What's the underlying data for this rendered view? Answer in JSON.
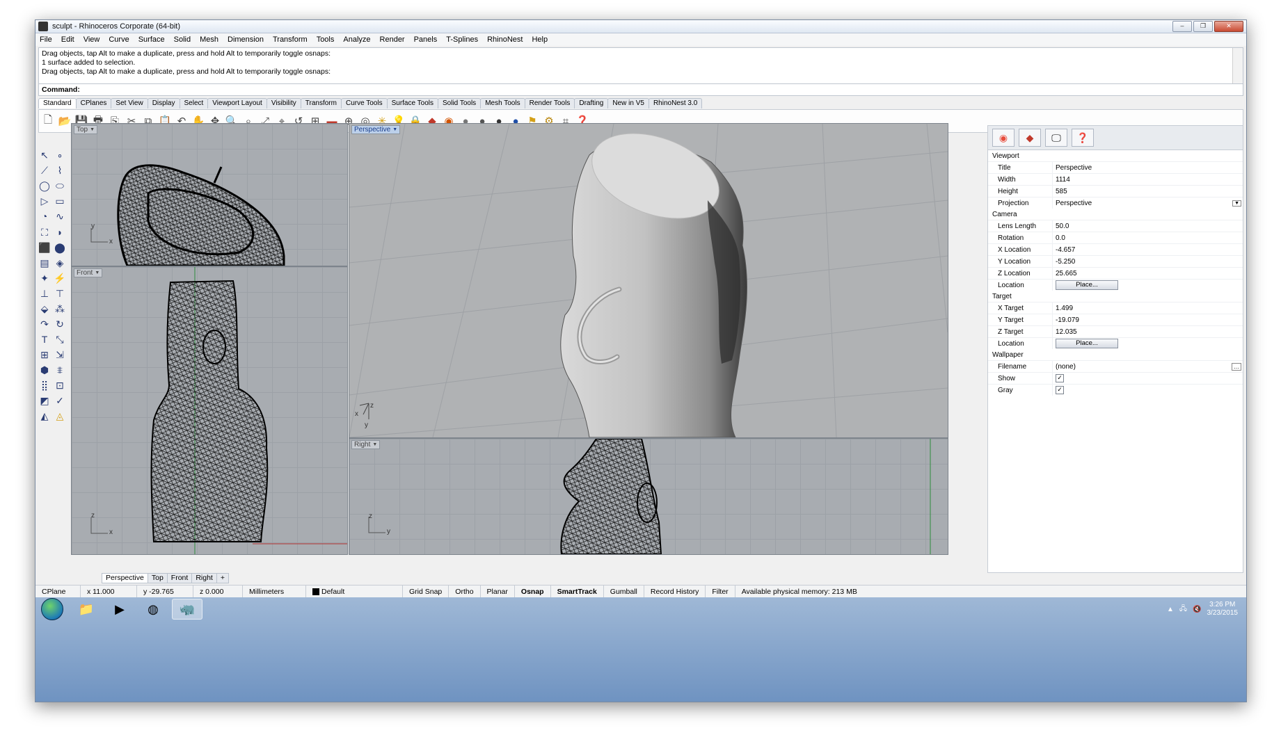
{
  "window": {
    "title": "sculpt - Rhinoceros Corporate (64-bit)",
    "controls": [
      "–",
      "❐",
      "✕"
    ]
  },
  "menu": [
    "File",
    "Edit",
    "View",
    "Curve",
    "Surface",
    "Solid",
    "Mesh",
    "Dimension",
    "Transform",
    "Tools",
    "Analyze",
    "Render",
    "Panels",
    "T-Splines",
    "RhinoNest",
    "Help"
  ],
  "command_history": [
    "Drag objects, tap Alt to make a duplicate, press and hold Alt to temporarily toggle osnaps:",
    "1 surface added to selection.",
    "Drag objects, tap Alt to make a duplicate, press and hold Alt to temporarily toggle osnaps:"
  ],
  "command": {
    "label": "Command:",
    "value": ""
  },
  "toolbar_tabs": [
    "Standard",
    "CPlanes",
    "Set View",
    "Display",
    "Select",
    "Viewport Layout",
    "Visibility",
    "Transform",
    "Curve Tools",
    "Surface Tools",
    "Solid Tools",
    "Mesh Tools",
    "Render Tools",
    "Drafting",
    "New in V5",
    "RhinoNest 3.0"
  ],
  "toolbar_icons": [
    "new-icon",
    "open-icon",
    "save-icon",
    "print-icon",
    "import-icon",
    "cut-icon",
    "copy-icon",
    "paste-icon",
    "undo-icon",
    "pan-icon",
    "rotate-view-icon",
    "zoom-icon",
    "zoom-window-icon",
    "zoom-extents-icon",
    "zoom-selected-icon",
    "undo-view-icon",
    "four-viewports-icon",
    "cplane-icon",
    "grid-icon",
    "osnap-icon",
    "point-icon",
    "light-icon",
    "lock-icon",
    "layer-icon",
    "material-icon",
    "render-sphere-icon",
    "shaded-sphere-icon",
    "rendered-sphere-icon",
    "blue-sphere-icon",
    "flag-icon",
    "settings-gear-icon",
    "gumball-icon",
    "help-icon"
  ],
  "viewports": {
    "top": {
      "label": "Top"
    },
    "front": {
      "label": "Front"
    },
    "perspective": {
      "label": "Perspective"
    },
    "right": {
      "label": "Right"
    }
  },
  "axes": {
    "x": "x",
    "y": "y",
    "z": "z"
  },
  "viewport_tabs": [
    "Perspective",
    "Top",
    "Front",
    "Right",
    "+"
  ],
  "properties": {
    "viewport_section": "Viewport",
    "viewport": [
      {
        "k": "Title",
        "v": "Perspective"
      },
      {
        "k": "Width",
        "v": "1114"
      },
      {
        "k": "Height",
        "v": "585"
      },
      {
        "k": "Projection",
        "v": "Perspective"
      }
    ],
    "camera_section": "Camera",
    "camera": [
      {
        "k": "Lens Length",
        "v": "50.0"
      },
      {
        "k": "Rotation",
        "v": "0.0"
      },
      {
        "k": "X Location",
        "v": "-4.657"
      },
      {
        "k": "Y Location",
        "v": "-5.250"
      },
      {
        "k": "Z Location",
        "v": "25.665"
      },
      {
        "k": "Location",
        "v": "Place..."
      }
    ],
    "target_section": "Target",
    "target": [
      {
        "k": "X Target",
        "v": "1.499"
      },
      {
        "k": "Y Target",
        "v": "-19.079"
      },
      {
        "k": "Z Target",
        "v": "12.035"
      },
      {
        "k": "Location",
        "v": "Place..."
      }
    ],
    "wallpaper_section": "Wallpaper",
    "wallpaper": [
      {
        "k": "Filename",
        "v": "(none)"
      },
      {
        "k": "Show",
        "v": "✓"
      },
      {
        "k": "Gray",
        "v": "✓"
      }
    ]
  },
  "status": {
    "cplane": "CPlane",
    "x": "x 11.000",
    "y": "y -29.765",
    "z": "z 0.000",
    "units": "Millimeters",
    "layer": "Default",
    "toggles": [
      "Grid Snap",
      "Ortho",
      "Planar",
      "Osnap",
      "SmartTrack",
      "Gumball",
      "Record History",
      "Filter"
    ],
    "memory": "Available physical memory: 213 MB"
  },
  "taskbar": {
    "time": "3:26 PM",
    "date": "3/23/2015"
  },
  "colors": {
    "viewport_bg": "#a8acb1",
    "active_viewport_tab": "#bcd0ea",
    "taskbar": "#6f93c1"
  }
}
